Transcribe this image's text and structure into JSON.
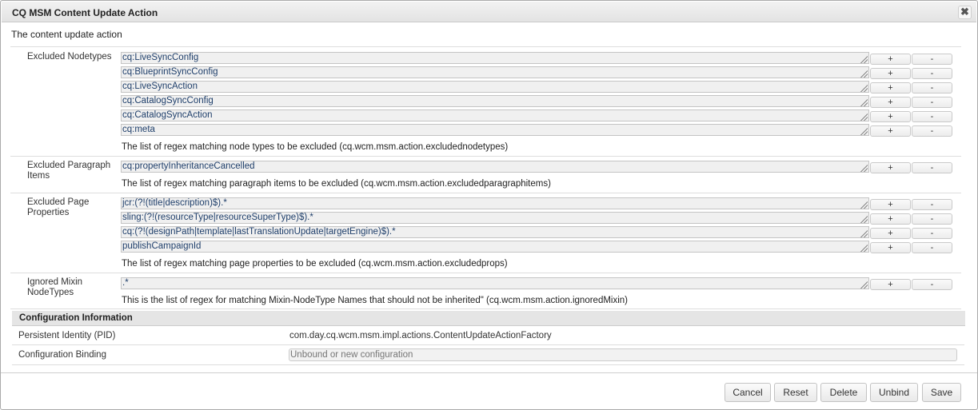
{
  "dialog": {
    "title": "CQ MSM Content Update Action",
    "close_label": "✖",
    "description": "The content update action"
  },
  "fields": {
    "excluded_nodetypes": {
      "label": "Excluded Nodetypes",
      "values": [
        "cq:LiveSyncConfig",
        "cq:BlueprintSyncConfig",
        "cq:LiveSyncAction",
        "cq:CatalogSyncConfig",
        "cq:CatalogSyncAction",
        "cq:meta"
      ],
      "hint": "The list of regex matching node types to be excluded (cq.wcm.msm.action.excludednodetypes)"
    },
    "excluded_paragraph_items": {
      "label": "Excluded Paragraph Items",
      "values": [
        "cq:propertyInheritanceCancelled"
      ],
      "hint": "The list of regex matching paragraph items to be excluded (cq.wcm.msm.action.excludedparagraphitems)"
    },
    "excluded_page_properties": {
      "label": "Excluded Page Properties",
      "values": [
        "jcr:(?!(title|description)$).*",
        "sling:(?!(resourceType|resourceSuperType)$).*",
        "cq:(?!(designPath|template|lastTranslationUpdate|targetEngine)$).*",
        "publishCampaignId"
      ],
      "hint": "The list of regex matching page properties to be excluded (cq.wcm.msm.action.excludedprops)"
    },
    "ignored_mixin_nodetypes": {
      "label": "Ignored Mixin NodeTypes",
      "values": [
        ".*"
      ],
      "hint": "This is the list of regex for matching Mixin-NodeType Names that should not be inherited\" (cq.wcm.msm.action.ignoredMixin)"
    }
  },
  "controls": {
    "plus_label": "+",
    "minus_label": "-"
  },
  "configuration": {
    "header": "Configuration Information",
    "pid_label": "Persistent Identity (PID)",
    "pid_value": "com.day.cq.wcm.msm.impl.actions.ContentUpdateActionFactory",
    "binding_label": "Configuration Binding",
    "binding_placeholder": "Unbound or new configuration"
  },
  "footer": {
    "cancel": "Cancel",
    "reset": "Reset",
    "delete": "Delete",
    "unbind": "Unbind",
    "save": "Save"
  }
}
